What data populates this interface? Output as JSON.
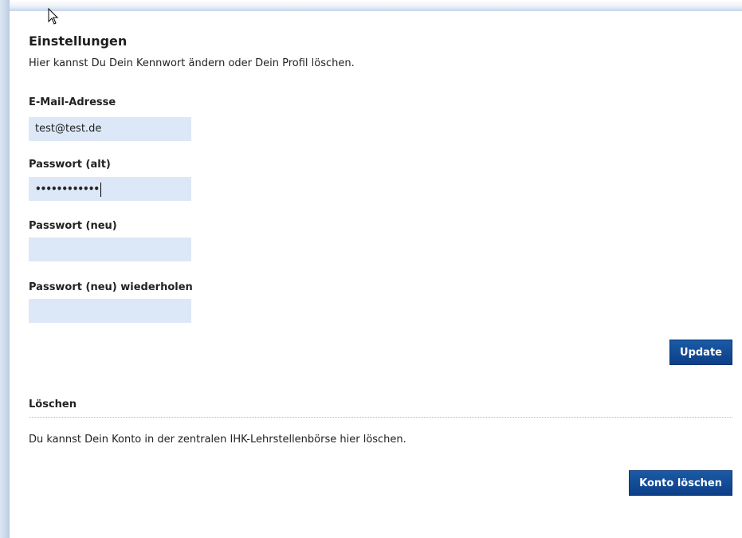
{
  "settings": {
    "title": "Einstellungen",
    "intro": "Hier kannst Du Dein Kennwort ändern oder Dein Profil löschen.",
    "email_label": "E-Mail-Adresse",
    "email_value": "test@test.de",
    "old_password_label": "Passwort (alt)",
    "old_password_value": "••••••••••••",
    "new_password_label": "Passwort (neu)",
    "new_password_value": "",
    "repeat_password_label": "Passwort (neu) wiederholen",
    "repeat_password_value": "",
    "update_button": "Update"
  },
  "delete_section": {
    "title": "Löschen",
    "text": "Du kannst Dein Konto in der zentralen IHK-Lehrstellenbörse hier löschen.",
    "delete_button": "Konto löschen"
  },
  "colors": {
    "input_background": "#dce8f7",
    "button_background": "#0d3f87",
    "rule_color": "#a9bfdc"
  },
  "icons": {
    "cursor": "mouse-pointer-icon"
  }
}
